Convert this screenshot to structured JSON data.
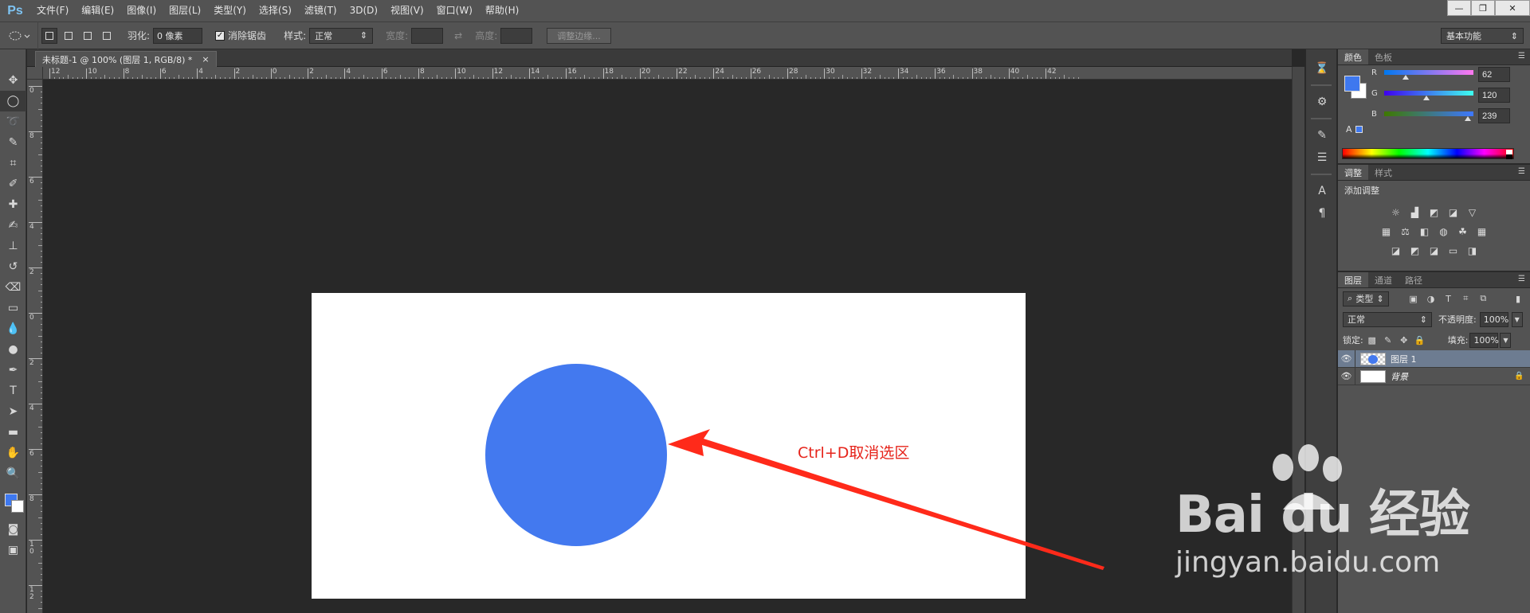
{
  "app": {
    "logo": "Ps",
    "menu": [
      "文件(F)",
      "编辑(E)",
      "图像(I)",
      "图层(L)",
      "类型(Y)",
      "选择(S)",
      "滤镜(T)",
      "3D(D)",
      "视图(V)",
      "窗口(W)",
      "帮助(H)"
    ],
    "window_controls": [
      "—",
      "❐",
      "✕"
    ]
  },
  "options": {
    "feather_label": "羽化:",
    "feather_value": "0 像素",
    "antialias_label": "消除锯齿",
    "antialias_checked": "✓",
    "style_label": "样式:",
    "style_value": "正常",
    "width_label": "宽度:",
    "height_label": "高度:",
    "refine_edge": "调整边缘...",
    "workspace": "基本功能"
  },
  "document": {
    "tab_title": "未标题-1 @ 100% (图层 1, RGB/8) *",
    "tab_close": "×",
    "ruler_top_labels": [
      "12",
      "10",
      "8",
      "6",
      "4",
      "2",
      "0",
      "2",
      "4",
      "6",
      "8",
      "10",
      "12",
      "14",
      "16",
      "18",
      "20",
      "22",
      "24",
      "26",
      "28",
      "30",
      "32",
      "34",
      "36",
      "38",
      "40",
      "42"
    ],
    "ruler_left_labels": [
      "0",
      "8",
      "6",
      "4",
      "2",
      "0",
      "2",
      "4",
      "6",
      "8",
      "1\n0",
      "1\n2"
    ],
    "annotation": "Ctrl+D取消选区"
  },
  "panels": {
    "color_tabs": [
      "颜色",
      "色板"
    ],
    "color": {
      "r_label": "R",
      "g_label": "G",
      "b_label": "B",
      "r": "62",
      "g": "120",
      "b": "239",
      "r_level": 0.243,
      "g_level": 0.471,
      "b_level": 0.937,
      "foreground": "#3e78ef",
      "background": "#ffffff"
    },
    "adjust_tabs": [
      "调整",
      "样式"
    ],
    "adjust_title": "添加调整",
    "layers_tabs": [
      "图层",
      "通道",
      "路径"
    ],
    "layers": {
      "filter_kind": "类型",
      "blend_mode": "正常",
      "opacity_label": "不透明度:",
      "opacity_value": "100%",
      "lock_label": "锁定:",
      "fill_label": "填充:",
      "fill_value": "100%",
      "items": [
        {
          "name": "图层 1",
          "selected": true
        },
        {
          "name": "背景",
          "selected": false,
          "locked": true
        }
      ]
    }
  },
  "watermark": {
    "brand": "Bai du 经验",
    "url": "jingyan.baidu.com"
  },
  "colors": {
    "circle": "#4379ef",
    "annotation": "#e6241b",
    "arrow": "#ff2a1a"
  }
}
